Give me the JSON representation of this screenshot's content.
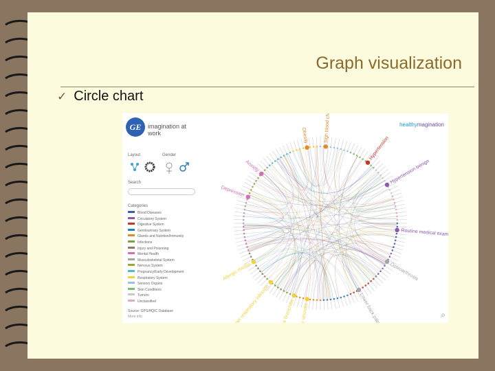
{
  "slide": {
    "title": "Graph visualization",
    "bullet": "Circle chart"
  },
  "app": {
    "logo_text": "imagination at work",
    "brand_prefix": "healthy",
    "brand_suffix": "magination",
    "layout_label": "Layout",
    "gender_label": "Gender",
    "search_label": "Search",
    "categories_label": "Categories",
    "categories": [
      {
        "label": "Blood Diseases",
        "color": "#3a5fa8"
      },
      {
        "label": "Circulatory System",
        "color": "#8d5aa9"
      },
      {
        "label": "Digestive System",
        "color": "#c0392b"
      },
      {
        "label": "Genitourinary System",
        "color": "#2a7fba"
      },
      {
        "label": "Glands and Nutrition/Immunity",
        "color": "#e08a2b"
      },
      {
        "label": "Infections",
        "color": "#7aa33c"
      },
      {
        "label": "Injury and Poisoning",
        "color": "#8f7b5d"
      },
      {
        "label": "Mental Health",
        "color": "#d070b8"
      },
      {
        "label": "Musculoskeletal System",
        "color": "#a5a5a5"
      },
      {
        "label": "Nervous System",
        "color": "#a2a23a"
      },
      {
        "label": "Pregnancy/Early Development",
        "color": "#58b6c8"
      },
      {
        "label": "Respiratory System",
        "color": "#f0d23a"
      },
      {
        "label": "Sensory Organs",
        "color": "#9dc1e3"
      },
      {
        "label": "Skin Conditions",
        "color": "#7bbf6a"
      },
      {
        "label": "Tumors",
        "color": "#c8c8c8"
      },
      {
        "label": "Unclassified",
        "color": "#e2a8c8"
      }
    ],
    "source_text": "Source: GPS/HQIC Database",
    "more_info": "More info",
    "nodes": [
      {
        "label": "high blood cholesterol",
        "color": "#e08a2b",
        "angle": -86
      },
      {
        "label": "Hypertension",
        "color": "#c0392b",
        "angle": -52
      },
      {
        "label": "Hypertension benign",
        "color": "#8d5aa9",
        "angle": -30
      },
      {
        "label": "Routine medical exam",
        "color": "#8d5aa9",
        "angle": 5
      },
      {
        "label": "Osteoarthrosis",
        "color": "#a5a5a5",
        "angle": 30
      },
      {
        "label": "Lower back pain",
        "color": "#a5a5a5",
        "angle": 60
      },
      {
        "label": "Upper respiratory infection",
        "color": "#f0d23a",
        "angle": 130
      },
      {
        "label": "Acute bronchitis",
        "color": "#f0d23a",
        "angle": 110
      },
      {
        "label": "Acute sinusitis",
        "color": "#f0d23a",
        "angle": 100
      },
      {
        "label": "Allergic rhinitis",
        "color": "#f0d23a",
        "angle": 150
      },
      {
        "label": "Obesity",
        "color": "#e08a2b",
        "angle": -100
      },
      {
        "label": "Anxiety",
        "color": "#d070b8",
        "angle": -140
      },
      {
        "label": "Depression",
        "color": "#d070b8",
        "angle": -160
      }
    ]
  }
}
